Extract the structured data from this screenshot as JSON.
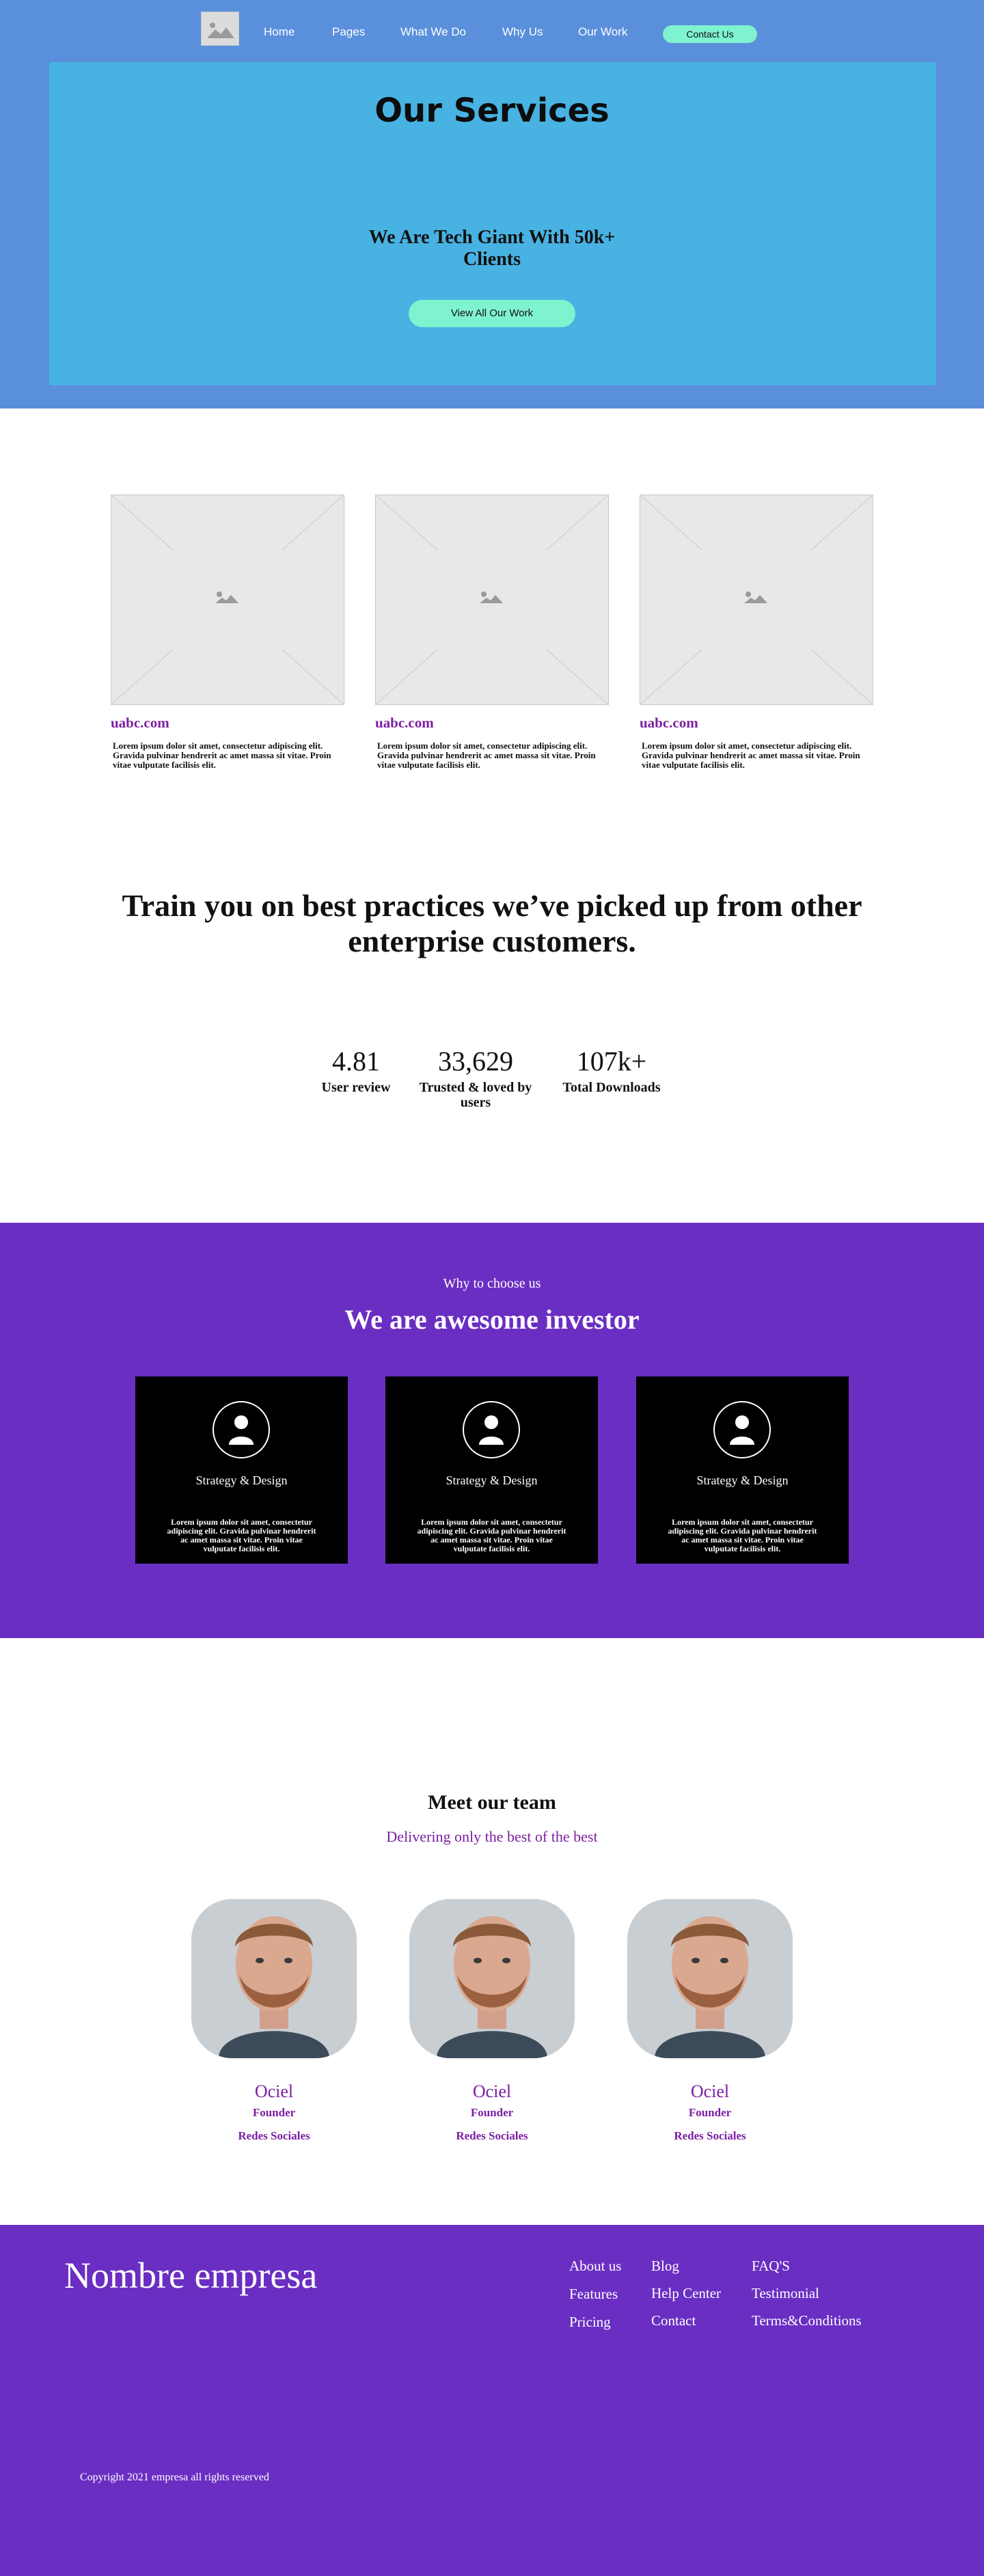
{
  "nav": {
    "logo_icon": "image-placeholder-icon",
    "links": [
      "Home",
      "Pages",
      "What We Do",
      "Why Us",
      "Our Work"
    ],
    "contact_label": "Contact Us"
  },
  "hero": {
    "title": "Our Services",
    "subtitle": "We Are Tech Giant With 50k+ Clients",
    "cta_label": "View All Our Work"
  },
  "cards": [
    {
      "link": "uabc.com",
      "text": "Lorem ipsum dolor sit amet, consectetur adipiscing elit. Gravida pulvinar hendrerit ac amet massa sit vitae. Proin vitae vulputate facilisis elit."
    },
    {
      "link": "uabc.com",
      "text": "Lorem ipsum dolor sit amet, consectetur adipiscing elit. Gravida pulvinar hendrerit ac amet massa sit vitae. Proin vitae vulputate facilisis elit."
    },
    {
      "link": "uabc.com",
      "text": "Lorem ipsum dolor sit amet, consectetur adipiscing elit. Gravida pulvinar hendrerit ac amet massa sit vitae. Proin vitae vulputate facilisis elit."
    }
  ],
  "train": {
    "heading": "Train you on best practices  we’ve picked up from other enterprise customers."
  },
  "stats": [
    {
      "value": "4.81",
      "label": "User review"
    },
    {
      "value": "33,629",
      "label": "Trusted & loved by users"
    },
    {
      "value": "107k+",
      "label": "Total Downloads"
    }
  ],
  "invest": {
    "eyebrow": "Why to choose us",
    "heading": "We are awesome investor",
    "cards": [
      {
        "icon": "user-icon",
        "title": "Strategy & Design",
        "text": "Lorem ipsum dolor sit amet, consectetur adipiscing elit. Gravida pulvinar hendrerit ac amet massa sit vitae. Proin vitae vulputate facilisis elit."
      },
      {
        "icon": "user-icon",
        "title": "Strategy & Design",
        "text": "Lorem ipsum dolor sit amet, consectetur adipiscing elit. Gravida pulvinar hendrerit ac amet massa sit vitae. Proin vitae vulputate facilisis elit."
      },
      {
        "icon": "user-icon",
        "title": "Strategy & Design",
        "text": "Lorem ipsum dolor sit amet, consectetur adipiscing elit. Gravida pulvinar hendrerit ac amet massa sit vitae. Proin vitae vulputate facilisis elit."
      }
    ]
  },
  "team": {
    "heading": "Meet our team",
    "subheading": "Delivering only the best of the best",
    "members": [
      {
        "name": "Ociel",
        "role": "Founder",
        "social": "Redes Sociales"
      },
      {
        "name": "Ociel",
        "role": "Founder",
        "social": "Redes Sociales"
      },
      {
        "name": "Ociel",
        "role": "Founder",
        "social": "Redes Sociales"
      }
    ]
  },
  "footer": {
    "brand": "Nombre empresa",
    "col1": [
      "About us",
      "Features",
      "Pricing"
    ],
    "col2": [
      "Blog",
      "Help Center",
      "Contact"
    ],
    "col3": [
      "FAQ'S",
      "Testimonial",
      "Terms&Conditions"
    ],
    "copyright": "Copyright 2021 empresa all rights reserved"
  },
  "colors": {
    "hero_bg": "#5a8fdc",
    "hero_panel": "#48b2e2",
    "accent_mint": "#7ff2cf",
    "purple_section": "#6a2ec3",
    "purple_text": "#7b1fa2"
  }
}
